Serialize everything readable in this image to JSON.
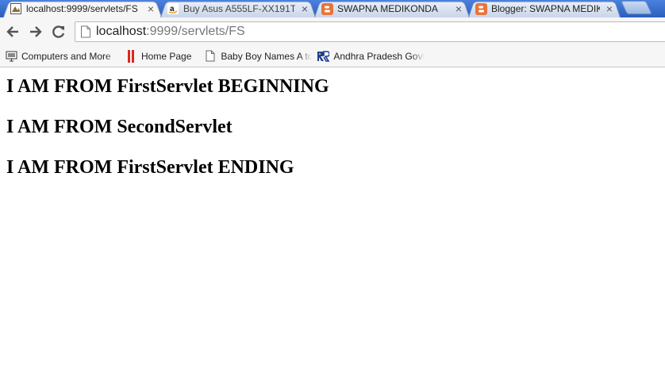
{
  "tabs": [
    {
      "title": "localhost:9999/servlets/FS",
      "icon": "page-icon",
      "active": true,
      "close": "×"
    },
    {
      "title": "Buy Asus A555LF-XX191T",
      "icon": "amazon-icon",
      "active": false,
      "close": "×"
    },
    {
      "title": "SWAPNA MEDIKONDA",
      "icon": "blogger-icon",
      "active": false,
      "close": "×"
    },
    {
      "title": "Blogger: SWAPNA MEDIKONDA",
      "icon": "blogger-icon",
      "active": false,
      "close": "×"
    }
  ],
  "toolbar": {
    "url_host": "localhost",
    "url_rest": ":9999/servlets/FS",
    "icons": [
      "back-arrow-icon",
      "forward-arrow-icon",
      "reload-icon",
      "page-icon"
    ]
  },
  "bookmarks": [
    {
      "label": "Computers and More",
      "icon": "monitor-icon"
    },
    {
      "label": "Home Page",
      "icon": "red-bars-icon"
    },
    {
      "label": "Baby Boy Names A to",
      "icon": "page-icon"
    },
    {
      "label": "Andhra Pradesh Govt",
      "icon": "ap-logo-icon"
    }
  ],
  "content": {
    "lines": [
      "I AM FROM FirstServlet BEGINNING",
      "I AM FROM SecondServlet",
      "I AM FROM FirstServlet ENDING"
    ]
  },
  "colors": {
    "tabstrip": "#2f65c4",
    "toolbar": "#f6f6f6",
    "blogger": "#e8743b",
    "home_page_icon": "#d52b1e"
  }
}
